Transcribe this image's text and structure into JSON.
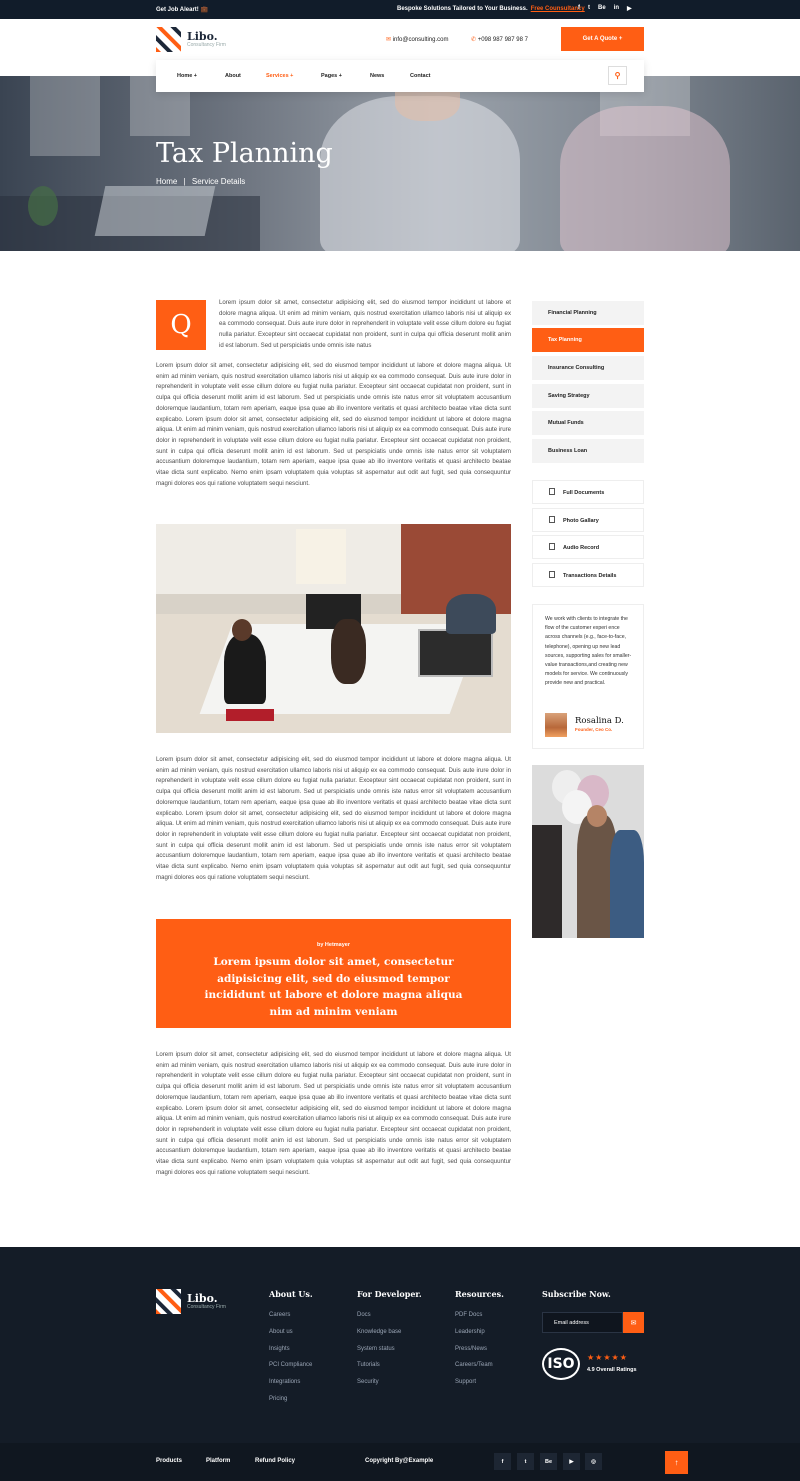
{
  "topbar": {
    "job_alert": "Get Job Aleart! 💼",
    "tagline": "Bespoke Solutions Tailored to Your Business.",
    "free_consult": "Free Counsultancy",
    "social": [
      "f",
      "t",
      "Be",
      "in",
      "▶"
    ]
  },
  "brand": {
    "name": "Libo.",
    "sub": "Consultancy Firm"
  },
  "header": {
    "email": "info@consulting.com",
    "phone": "+098 987 987 98 7",
    "quote_button": "Get A Quote +"
  },
  "nav": {
    "items": [
      "Home +",
      "About",
      "Services +",
      "Pages +",
      "News",
      "Contact"
    ],
    "search_icon": "search-icon"
  },
  "hero": {
    "title": "Tax Planning",
    "crumb_home": "Home",
    "crumb_sep": "|",
    "crumb_current": "Service Details"
  },
  "content": {
    "dropcap": "Q",
    "intro": "Lorem ipsum dolor sit amet, consectetur adipisicing elit, sed do eiusmod tempor incididunt ut labore et dolore magna aliqua. Ut enim ad minim veniam, quis nostrud exercitation ullamco laboris nisi ut aliquip ex ea commodo consequat. Duis aute irure dolor in reprehenderit in voluptate velit esse cillum dolore eu fugiat nulla pariatur. Excepteur sint occaecat cupidatat non proident, sunt in culpa qui officia deserunt mollit anim id est laborum. Sed ut perspiciatis unde omnis iste natus",
    "body": "Lorem ipsum dolor sit amet, consectetur adipisicing elit, sed do eiusmod tempor incididunt ut labore et dolore magna aliqua. Ut enim ad minim veniam, quis nostrud exercitation ullamco laboris nisi ut aliquip ex ea commodo consequat. Duis aute irure dolor in reprehenderit in voluptate velit esse cillum dolore eu fugiat nulla pariatur. Excepteur sint occaecat cupidatat non proident, sunt in culpa qui officia deserunt mollit anim id est laborum. Sed ut perspiciatis unde omnis iste natus error sit voluptatem accusantium doloremque laudantium, totam rem aperiam, eaque ipsa quae ab illo inventore veritatis et quasi architecto beatae vitae dicta sunt explicabo. Lorem ipsum dolor sit amet, consectetur adipisicing elit, sed do eiusmod tempor incididunt ut labore et dolore magna aliqua. Ut enim ad minim veniam, quis nostrud exercitation ullamco laboris nisi ut aliquip ex ea commodo consequat. Duis aute irure dolor in reprehenderit in voluptate velit esse cillum dolore eu fugiat nulla pariatur. Excepteur sint occaecat cupidatat non proident, sunt in culpa qui officia deserunt mollit anim id est laborum. Sed ut perspiciatis unde omnis iste natus error sit voluptatem accusantium doloremque laudantium, totam rem aperiam, eaque ipsa quae ab illo inventore veritatis et quasi architecto beatae vitae dicta sunt explicabo. Nemo enim ipsam voluptatem quia voluptas sit aspernatur aut odit aut fugit, sed quia consequuntur magni dolores eos qui ratione voluptatem sequi nesciunt.",
    "quote_by": "by Hetmayer",
    "quote_text": "Lorem ipsum dolor sit amet, consectetur adipisicing elit, sed do eiusmod tempor incididunt ut labore et dolore magna aliqua nim ad minim veniam"
  },
  "sidebar": {
    "services": [
      "Financial Planning",
      "Tax Planning",
      "Insurance Consulting",
      "Saving Strategy",
      "Mutual Funds",
      "Business Loan"
    ],
    "docs": [
      "Full Documents",
      "Photo Gallary",
      "Audio Record",
      "Transactions Details"
    ],
    "testimonial": "We work with clients to integrate the flow of the customer experi ence across channels (e.g., face-to-face, telephone), opening up new lead sources, supporting sales for smaller-value transactions,and creating new models for service. We continuously provide new and practical.",
    "author_name": "Rosalina D.",
    "author_role": "Founder, Ceo Co."
  },
  "footer": {
    "cols": [
      {
        "title": "About Us.",
        "links": [
          "Careers",
          "About us",
          "Insights",
          "PCI Compliance",
          "Integrations",
          "Pricing"
        ]
      },
      {
        "title": "For Developer.",
        "links": [
          "Docs",
          "Knowledge base",
          "System status",
          "Tutorials",
          "Security"
        ]
      },
      {
        "title": "Resources.",
        "links": [
          "PDF Docs",
          "Leadership",
          "Press/News",
          "Careers/Team",
          "Support"
        ]
      }
    ],
    "subscribe_title": "Subscribe Now.",
    "email_placeholder": "Email address",
    "iso": "ISO",
    "stars": "★★★★★",
    "rating": "4.9 Overall Ratings"
  },
  "bottom": {
    "links": [
      "Products",
      "Platform",
      "Refund Policy"
    ],
    "copyright": "Copyright By@Example",
    "social": [
      "f",
      "t",
      "Be",
      "▶",
      "◎"
    ],
    "up": "↑"
  },
  "colors": {
    "accent": "#ff5e14",
    "dark": "#141c27"
  }
}
